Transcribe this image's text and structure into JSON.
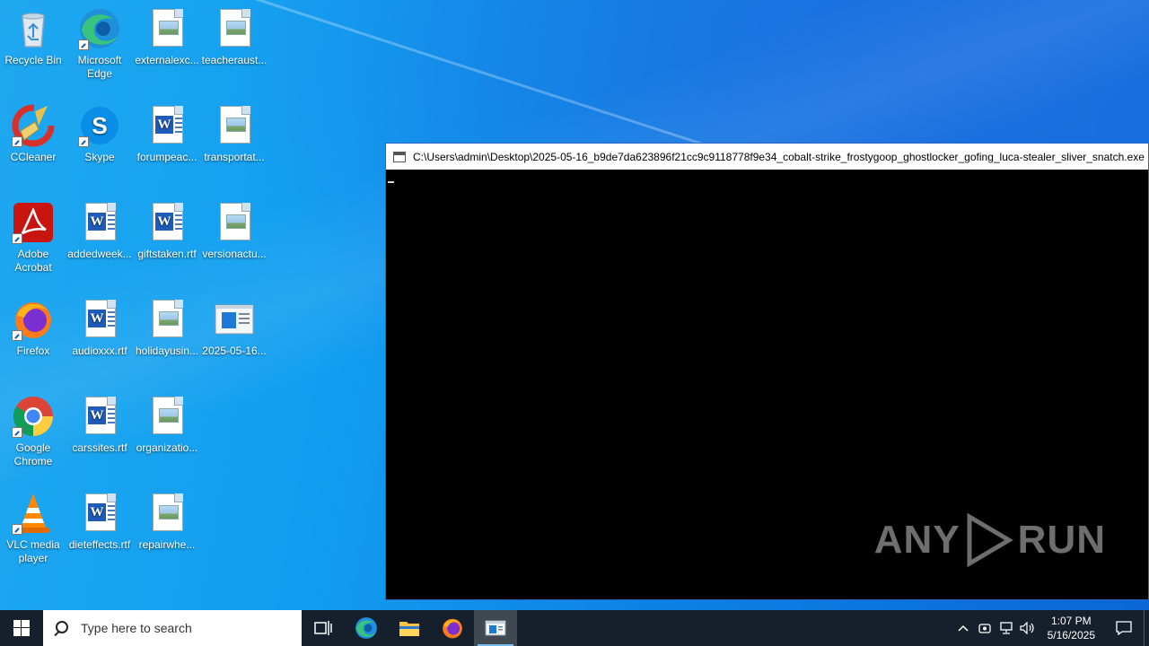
{
  "desktop": {
    "icons": [
      {
        "label": "Recycle Bin"
      },
      {
        "label": "Microsoft Edge"
      },
      {
        "label": "externalexc..."
      },
      {
        "label": "teacheraust..."
      },
      {
        "label": "CCleaner"
      },
      {
        "label": "Skype"
      },
      {
        "label": "forumpeac..."
      },
      {
        "label": "transportat..."
      },
      {
        "label": "Adobe Acrobat"
      },
      {
        "label": "addedweek..."
      },
      {
        "label": "giftstaken.rtf"
      },
      {
        "label": "versionactu..."
      },
      {
        "label": "Firefox"
      },
      {
        "label": "audioxxx.rtf"
      },
      {
        "label": "holidayusin..."
      },
      {
        "label": "2025-05-16..."
      },
      {
        "label": "Google Chrome"
      },
      {
        "label": "carssites.rtf"
      },
      {
        "label": "organizatio..."
      },
      {
        "label": "VLC media player"
      },
      {
        "label": "dieteffects.rtf"
      },
      {
        "label": "repairwhe..."
      }
    ]
  },
  "console": {
    "title": "C:\\Users\\admin\\Desktop\\2025-05-16_b9de7da623896f21cc9c9118778f9e34_cobalt-strike_frostygoop_ghostlocker_gofing_luca-stealer_sliver_snatch.exe"
  },
  "watermark": {
    "left": "ANY",
    "right": "RUN"
  },
  "taskbar": {
    "search_placeholder": "Type here to search",
    "time": "1:07 PM",
    "date": "5/16/2025"
  }
}
